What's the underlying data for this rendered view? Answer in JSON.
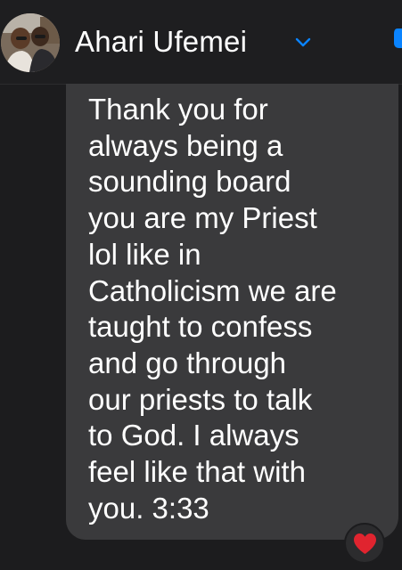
{
  "header": {
    "contact_name": "Ahari Ufemei",
    "chevron_icon": "chevron-down-icon",
    "accent_color": "#0a84ff"
  },
  "message": {
    "text": "Thank you for\nalways being a\nsounding board\nyou are my Priest\nlol like in\nCatholicism we are\ntaught to confess\nand go through\nour priests to talk\nto God. I always\nfeel like that with\nyou. 3:33",
    "bubble_color": "#3a3a3c",
    "text_color": "#ffffff"
  },
  "reaction": {
    "icon": "heart-icon",
    "color": "#e0242f"
  }
}
